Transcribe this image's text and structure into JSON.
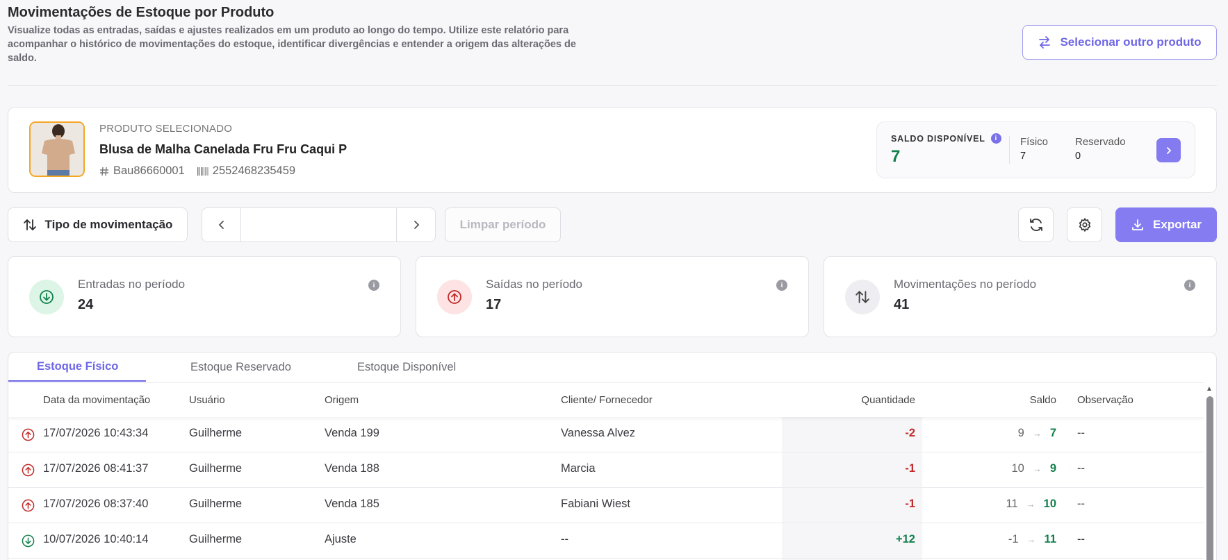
{
  "header": {
    "title": "Movimentações de Estoque por Produto",
    "description": "Visualize todas as entradas, saídas e ajustes realizados em um produto ao longo do tempo. Utilize este relatório para acompanhar o histórico de movimentações do estoque, identificar divergências e entender a origem das alterações de saldo.",
    "select_product_label": "Selecionar outro produto"
  },
  "product": {
    "overline": "PRODUTO SELECIONADO",
    "name": "Blusa de Malha Canelada Fru Fru Caqui P",
    "sku": "Bau86660001",
    "barcode": "2552468235459"
  },
  "saldo": {
    "label": "SALDO DISPONÍVEL",
    "value": "7",
    "fisico_label": "Físico",
    "fisico_value": "7",
    "reservado_label": "Reservado",
    "reservado_value": "0"
  },
  "toolbar": {
    "tipo_label": "Tipo de movimentação",
    "date_value": "",
    "clear_label": "Limpar período",
    "export_label": "Exportar"
  },
  "stats": [
    {
      "label": "Entradas no período",
      "value": "24",
      "color": "#12804d"
    },
    {
      "label": "Saídas no período",
      "value": "17",
      "color": "#c22a2a"
    },
    {
      "label": "Movimentações no período",
      "value": "41",
      "color": "#444444"
    }
  ],
  "tabs": [
    "Estoque Físico",
    "Estoque Reservado",
    "Estoque Disponível"
  ],
  "columns": {
    "date": "Data da movimentação",
    "user": "Usuário",
    "origin": "Origem",
    "client": "Cliente/ Fornecedor",
    "qty": "Quantidade",
    "saldo": "Saldo",
    "obs": "Observação"
  },
  "rows": [
    {
      "type": "saida",
      "date": "17/07/2026 10:43:34",
      "user": "Guilherme",
      "origin": "Venda 199",
      "client": "Vanessa Alvez",
      "qty": "-2",
      "from": "9",
      "to": "7",
      "obs": "--"
    },
    {
      "type": "saida",
      "date": "17/07/2026 08:41:37",
      "user": "Guilherme",
      "origin": "Venda 188",
      "client": "Marcia",
      "qty": "-1",
      "from": "10",
      "to": "9",
      "obs": "--"
    },
    {
      "type": "saida",
      "date": "17/07/2026 08:37:40",
      "user": "Guilherme",
      "origin": "Venda 185",
      "client": "Fabiani Wiest",
      "qty": "-1",
      "from": "11",
      "to": "10",
      "obs": "--"
    },
    {
      "type": "entrada",
      "date": "10/07/2026 10:40:14",
      "user": "Guilherme",
      "origin": "Ajuste",
      "client": "--",
      "qty": "+12",
      "from": "-1",
      "to": "11",
      "obs": "--"
    }
  ],
  "colors": {
    "accent": "#867cf2",
    "positive": "#12804d",
    "negative": "#c22a2a"
  }
}
